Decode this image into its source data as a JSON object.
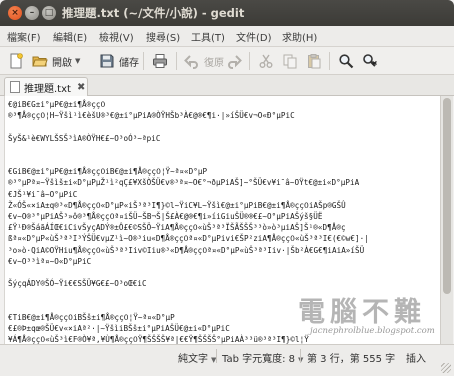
{
  "window": {
    "title": "推理題.txt (~/文件/小說) - gedit"
  },
  "menu": [
    "檔案(F)",
    "編輯(E)",
    "檢視(V)",
    "搜尋(S)",
    "工具(T)",
    "文件(D)",
    "求助(H)"
  ],
  "toolbar": {
    "new_icon": "new-document-icon",
    "open_label": "開啟",
    "save_label": "儲存",
    "undo_label": "復原",
    "print_icon": "printer-icon",
    "redo_icon": "redo-icon",
    "cut_icon": "scissors-icon",
    "copy_icon": "copy-icon",
    "paste_icon": "paste-icon",
    "find_icon": "search-icon",
    "replace_icon": "find-replace-icon"
  },
  "tab": {
    "name": "推理題.txt",
    "close_icon": "close-icon"
  },
  "editor": {
    "lines": [
      "€@iB€G±i°µP€@±i¶Å®çç߀",
      "®³¶Å®çç߀¦H~Ÿšì¹ì€èšU®³€@±i°µPiA®ÒŸHŠb³À€@®€¶i·|»íŠÜ€v¬O«Ð°µPiC",
      "",
      "ŠyŠ&¹è€WYLŠSŠ³ìA®ÒŸH€£~O³oÓ³~ªpiC",
      "",
      "",
      "€GiB€@±i°µP€@±i¶Å®çç߀iB€@±i¶Å®çç߀¦Ÿ~ª¤«D°µP",
      "®³°µPª¤~Ÿšìš±i«D°µPµŽ¹ì²qÇ£¥XšÒŠÜ€v®³ª¤~O€°¬ðµPiAŠ]~°ŠÜ€v¥i¯â~OŸt€@±i«D°µPiA",
      "€JŠ¹¥i¯â~O°µPiC",
      "Ž«ÓŠ«×iA±q®³«D¶Å®çç߀«D°µP«iŠ³ª³I¶}©l~ŸiC¥L~Ÿšì€@±i°µPiB€@±i¶Å®çç߀iAŠp®GŠÛ",
      "€v~O®³°µPiAŠ³»ô®³¶Å®çç߀ª¤iŠÜ~ŠB¬Š|Š£À€@®€¶i»íiGiuŠÜ®®€£~O°µPiAŠýš§ÜË",
      "£Ÿ¹Ð®ŠáãÁÍŒ€iCivŠyçADÝ®±Ô£€©SŠÖ~ŸiA¶Å®çç߀«ùŠ³ª³ÏŠÃŠŠŠ³³ò»ò³µiAŠ]Š¹®«D¶Å®ç",
      "ßª¤«D°µP«ùŠ³ª³I³ÝŠÜ€vµZ¹ì~O®³iu«D¶Å®çç߀ª¤«D°µPivi€ŠP²ziA¶Å®çç߀«ùŠ³ª³I€(€©w€]·|",
      "³o»ò·QiA©OŸHiu¶Å®çç߀«ùŠ³ª³Iiv©Iiu®³«D¶Å®çç߀ª¤«D°µP«ùŠ³ª³Iiv·|Šb²À€G€¶iAiA»íŠÜ",
      "€v~O³³ìª¤~O«D°µPiC",
      "",
      "ŠýçqÁDY®ŠÓ~Ÿi€€SŠÜ¥G€£~O³oŒ€iC",
      "",
      "",
      "€TiB€@±i¶Å®çç߀iBŠš±i¶Å®çç߀¦Ÿ~ª¤«D°µP",
      "€£®Þ±qœ®ŠÜ€v«×iAª²·|~ŸšìiBŠš±i°µPiAŠÜ€@±i«D°µPiC",
      "¥Á¶Å®çç߀«ùŠ³ì€F®Ò¥ª,¥Ù¶Å®çç߀Ÿ¶ŠŠŠŠ¥ª|€€Ÿ¶ŠŠŠŠ°µPiAÀ³³ü®³ª³I¶}©l¦Ÿ"
    ]
  },
  "statusbar": {
    "language": "純文字",
    "tab_width": "Tab 字元寬度: 8",
    "position": "第 3 行，第 555 字",
    "mode": "插入"
  },
  "watermark": {
    "text": "電腦不難",
    "url": "jacnephrolblue.blogspot.com"
  }
}
